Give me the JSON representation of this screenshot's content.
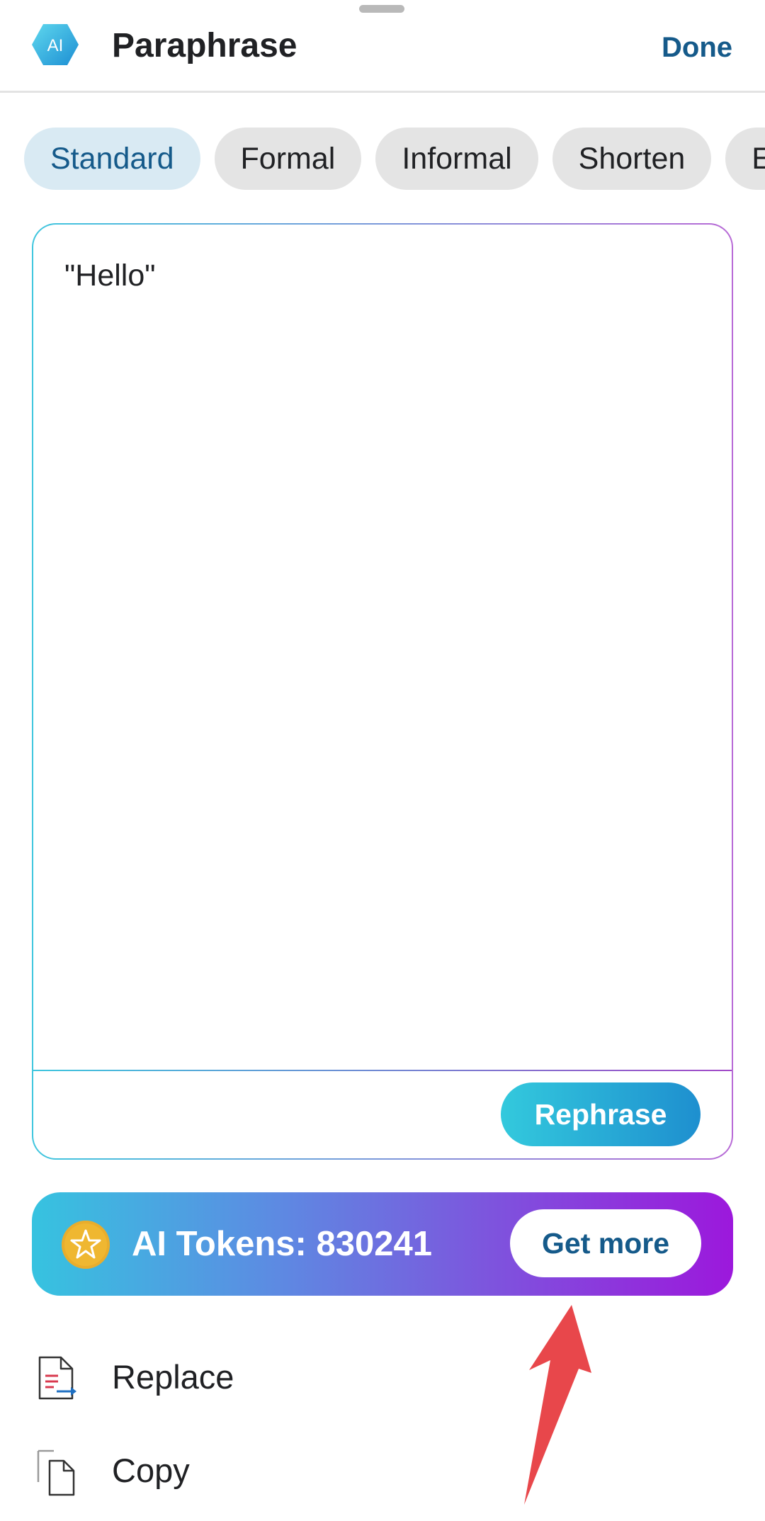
{
  "header": {
    "logo_text": "AI",
    "title": "Paraphrase",
    "done_label": "Done"
  },
  "modes": [
    {
      "label": "Standard",
      "active": true
    },
    {
      "label": "Formal",
      "active": false
    },
    {
      "label": "Informal",
      "active": false
    },
    {
      "label": "Shorten",
      "active": false
    },
    {
      "label": "Expand",
      "active": false
    }
  ],
  "editor": {
    "text": "\"Hello\"",
    "rephrase_label": "Rephrase"
  },
  "tokens": {
    "label": "AI Tokens: 830241",
    "get_more_label": "Get more"
  },
  "actions": [
    {
      "label": "Replace",
      "icon": "replace-icon"
    },
    {
      "label": "Copy",
      "icon": "copy-icon"
    }
  ],
  "colors": {
    "accent": "#155a8a",
    "gradient_start": "#36c3e0",
    "gradient_end": "#9c18dc",
    "annotation_arrow": "#e8474b"
  }
}
